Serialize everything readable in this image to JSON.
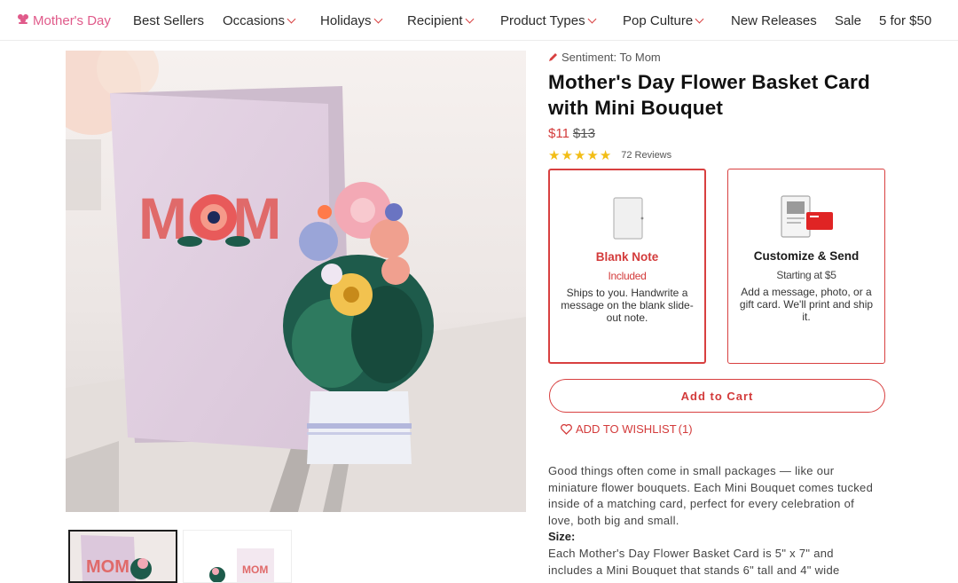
{
  "nav": {
    "items": [
      {
        "label": "Mother's Day",
        "has_chevron": false,
        "icon": "flower-icon"
      },
      {
        "label": "Best Sellers",
        "has_chevron": false
      },
      {
        "label": "Occasions",
        "has_chevron": true
      },
      {
        "label": "Holidays",
        "has_chevron": true
      },
      {
        "label": "Recipient",
        "has_chevron": true
      },
      {
        "label": "Product Types",
        "has_chevron": true
      },
      {
        "label": "Pop Culture",
        "has_chevron": true
      },
      {
        "label": "New Releases",
        "has_chevron": false
      },
      {
        "label": "Sale",
        "has_chevron": false
      },
      {
        "label": "5 for $50",
        "has_chevron": false
      }
    ]
  },
  "gallery": {
    "card_text": "MOM",
    "thumb_text": "MOM"
  },
  "product": {
    "sentiment": "Sentiment: To Mom",
    "title": "Mother's Day Flower Basket Card with Mini Bouquet",
    "price": "$11",
    "old_price": "$13",
    "stars": 5,
    "reviews": "72 Reviews"
  },
  "options": [
    {
      "title": "Blank Note",
      "subtitle": "Included",
      "description": "Ships to you. Handwrite a message on the blank slide-out note.",
      "icon": "blank-note-icon"
    },
    {
      "title": "Customize & Send",
      "subtitle": "Starting at $5",
      "description": "Add a message, photo, or a gift card. We'll print and ship it.",
      "icon": "customize-card-icon"
    }
  ],
  "actions": {
    "add_to_cart": "Add to Cart",
    "wishlist": "ADD TO WISHLIST",
    "wishlist_count": "(1)"
  },
  "details": {
    "description": "Good things often come in small packages — like our miniature flower bouquets. Each Mini Bouquet comes tucked inside of a matching card, perfect for every celebration of love, both big and small.",
    "size_heading": "Size:",
    "size_text": "Each Mother's Day Flower Basket Card is 5\" x 7\" and includes a Mini Bouquet that stands 6\" tall and 4\" wide"
  },
  "colors": {
    "accent": "#d84040",
    "nav_highlight": "#e05a8a",
    "star": "#f2bd16"
  }
}
